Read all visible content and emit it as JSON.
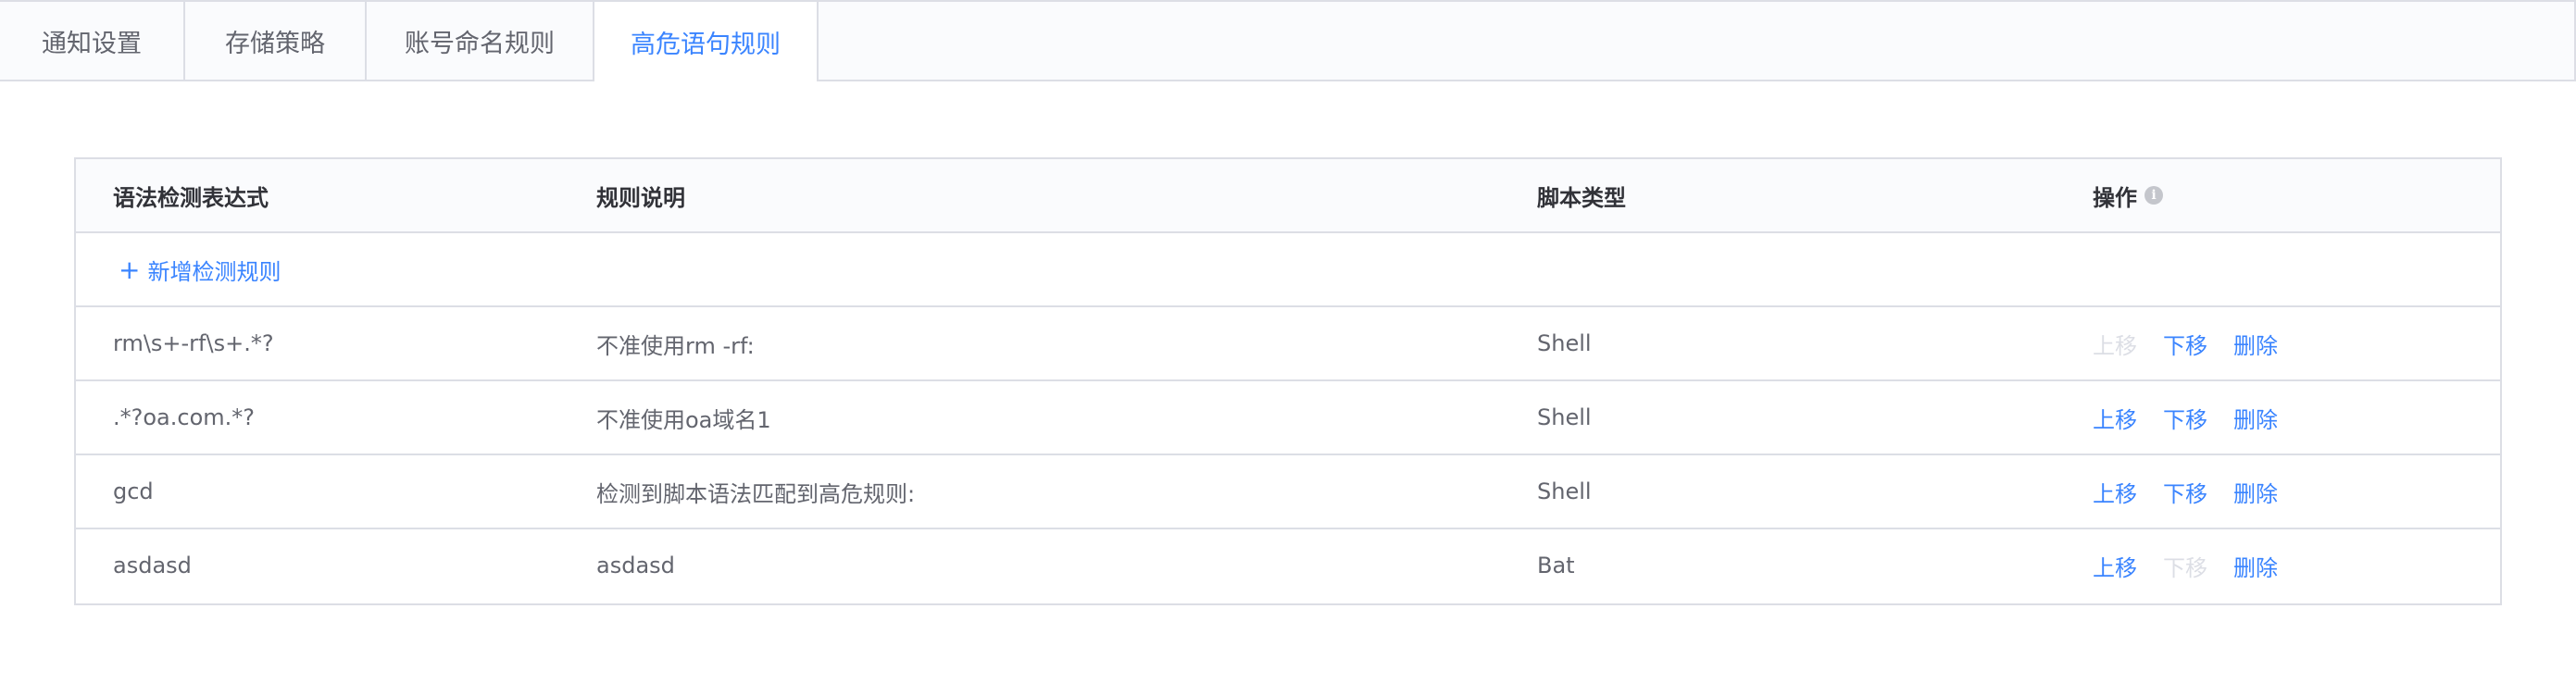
{
  "tabs": [
    {
      "label": "通知设置",
      "active": false
    },
    {
      "label": "存储策略",
      "active": false
    },
    {
      "label": "账号命名规则",
      "active": false
    },
    {
      "label": "高危语句规则",
      "active": true
    }
  ],
  "table": {
    "headers": {
      "expression": "语法检测表达式",
      "description": "规则说明",
      "script_type": "脚本类型",
      "actions": "操作"
    },
    "add_rule_label": "新增检测规则",
    "rows": [
      {
        "expression": "rm\\s+-rf\\s+.*?",
        "description": "不准使用rm -rf:",
        "script_type": "Shell",
        "up": "上移",
        "down": "下移",
        "delete": "删除",
        "up_disabled": true,
        "down_disabled": false
      },
      {
        "expression": ".*?oa.com.*?",
        "description": "不准使用oa域名1",
        "script_type": "Shell",
        "up": "上移",
        "down": "下移",
        "delete": "删除",
        "up_disabled": false,
        "down_disabled": false
      },
      {
        "expression": "gcd",
        "description": "检测到脚本语法匹配到高危规则:",
        "script_type": "Shell",
        "up": "上移",
        "down": "下移",
        "delete": "删除",
        "up_disabled": false,
        "down_disabled": false
      },
      {
        "expression": "asdasd",
        "description": "asdasd",
        "script_type": "Bat",
        "up": "上移",
        "down": "下移",
        "delete": "删除",
        "up_disabled": false,
        "down_disabled": true
      }
    ]
  },
  "colors": {
    "accent": "#3a84ff",
    "disabled": "#dcdee5",
    "border": "#dcdee5",
    "header_bg": "#fafbfd"
  },
  "icons": {
    "info": "info-circle-icon",
    "add": "plus-icon"
  }
}
